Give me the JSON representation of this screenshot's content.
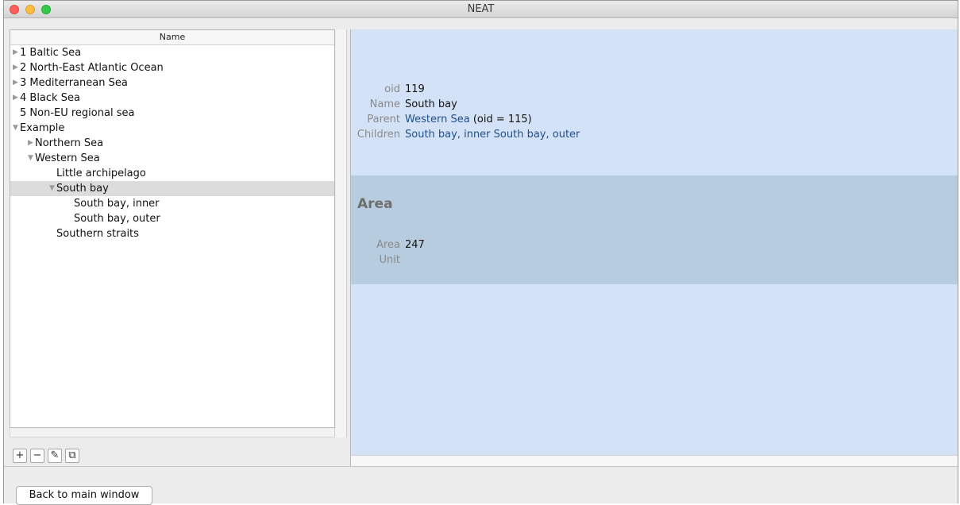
{
  "window": {
    "title": "NEAT"
  },
  "tree": {
    "column_header": "Name",
    "rows": [
      {
        "label": "1 Baltic Sea",
        "triangle": "▶"
      },
      {
        "label": "2 North-East Atlantic Ocean",
        "triangle": "▶"
      },
      {
        "label": "3 Mediterranean Sea",
        "triangle": "▶"
      },
      {
        "label": "4 Black Sea",
        "triangle": "▶"
      },
      {
        "label": "5 Non-EU regional sea",
        "triangle": ""
      },
      {
        "label": "Example",
        "triangle": "▼"
      },
      {
        "label": "Northern Sea",
        "triangle": "▶"
      },
      {
        "label": "Western Sea",
        "triangle": "▼"
      },
      {
        "label": "Little archipelago",
        "triangle": ""
      },
      {
        "label": "South bay",
        "triangle": "▼"
      },
      {
        "label": "South bay, inner",
        "triangle": ""
      },
      {
        "label": "South bay, outer",
        "triangle": ""
      },
      {
        "label": "Southern straits",
        "triangle": ""
      }
    ]
  },
  "toolbar": {
    "add": "+",
    "remove": "−",
    "edit": "✎",
    "copy": "⧉"
  },
  "details": {
    "oid_label": "oid",
    "oid_value": "119",
    "name_label": "Name",
    "name_value": "South bay",
    "parent_label": "Parent",
    "parent_link": "Western Sea",
    "parent_suffix": "(oid = 115)",
    "children_label": "Children",
    "children_links": "South bay, inner South bay, outer"
  },
  "area": {
    "title": "Area",
    "area_label": "Area",
    "area_value": "247",
    "unit_label": "Unit",
    "unit_value": ""
  },
  "footer": {
    "back_label": "Back to main window"
  },
  "icons": {
    "add": "plus-icon",
    "remove": "minus-icon",
    "edit": "pencil-icon",
    "copy": "copy-icon"
  }
}
